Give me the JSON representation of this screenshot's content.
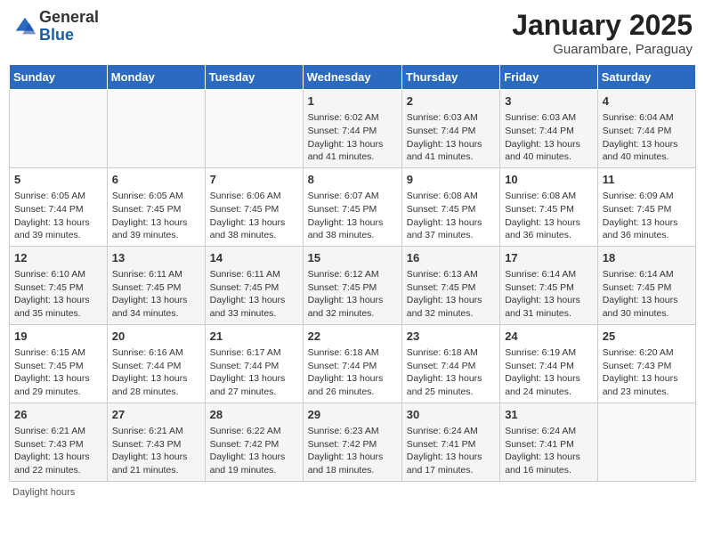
{
  "header": {
    "logo_general": "General",
    "logo_blue": "Blue",
    "month_year": "January 2025",
    "location": "Guarambare, Paraguay"
  },
  "footer": {
    "daylight_label": "Daylight hours"
  },
  "calendar": {
    "days_of_week": [
      "Sunday",
      "Monday",
      "Tuesday",
      "Wednesday",
      "Thursday",
      "Friday",
      "Saturday"
    ],
    "weeks": [
      [
        {
          "day": "",
          "info": ""
        },
        {
          "day": "",
          "info": ""
        },
        {
          "day": "",
          "info": ""
        },
        {
          "day": "1",
          "info": "Sunrise: 6:02 AM\nSunset: 7:44 PM\nDaylight: 13 hours\nand 41 minutes."
        },
        {
          "day": "2",
          "info": "Sunrise: 6:03 AM\nSunset: 7:44 PM\nDaylight: 13 hours\nand 41 minutes."
        },
        {
          "day": "3",
          "info": "Sunrise: 6:03 AM\nSunset: 7:44 PM\nDaylight: 13 hours\nand 40 minutes."
        },
        {
          "day": "4",
          "info": "Sunrise: 6:04 AM\nSunset: 7:44 PM\nDaylight: 13 hours\nand 40 minutes."
        }
      ],
      [
        {
          "day": "5",
          "info": "Sunrise: 6:05 AM\nSunset: 7:44 PM\nDaylight: 13 hours\nand 39 minutes."
        },
        {
          "day": "6",
          "info": "Sunrise: 6:05 AM\nSunset: 7:45 PM\nDaylight: 13 hours\nand 39 minutes."
        },
        {
          "day": "7",
          "info": "Sunrise: 6:06 AM\nSunset: 7:45 PM\nDaylight: 13 hours\nand 38 minutes."
        },
        {
          "day": "8",
          "info": "Sunrise: 6:07 AM\nSunset: 7:45 PM\nDaylight: 13 hours\nand 38 minutes."
        },
        {
          "day": "9",
          "info": "Sunrise: 6:08 AM\nSunset: 7:45 PM\nDaylight: 13 hours\nand 37 minutes."
        },
        {
          "day": "10",
          "info": "Sunrise: 6:08 AM\nSunset: 7:45 PM\nDaylight: 13 hours\nand 36 minutes."
        },
        {
          "day": "11",
          "info": "Sunrise: 6:09 AM\nSunset: 7:45 PM\nDaylight: 13 hours\nand 36 minutes."
        }
      ],
      [
        {
          "day": "12",
          "info": "Sunrise: 6:10 AM\nSunset: 7:45 PM\nDaylight: 13 hours\nand 35 minutes."
        },
        {
          "day": "13",
          "info": "Sunrise: 6:11 AM\nSunset: 7:45 PM\nDaylight: 13 hours\nand 34 minutes."
        },
        {
          "day": "14",
          "info": "Sunrise: 6:11 AM\nSunset: 7:45 PM\nDaylight: 13 hours\nand 33 minutes."
        },
        {
          "day": "15",
          "info": "Sunrise: 6:12 AM\nSunset: 7:45 PM\nDaylight: 13 hours\nand 32 minutes."
        },
        {
          "day": "16",
          "info": "Sunrise: 6:13 AM\nSunset: 7:45 PM\nDaylight: 13 hours\nand 32 minutes."
        },
        {
          "day": "17",
          "info": "Sunrise: 6:14 AM\nSunset: 7:45 PM\nDaylight: 13 hours\nand 31 minutes."
        },
        {
          "day": "18",
          "info": "Sunrise: 6:14 AM\nSunset: 7:45 PM\nDaylight: 13 hours\nand 30 minutes."
        }
      ],
      [
        {
          "day": "19",
          "info": "Sunrise: 6:15 AM\nSunset: 7:45 PM\nDaylight: 13 hours\nand 29 minutes."
        },
        {
          "day": "20",
          "info": "Sunrise: 6:16 AM\nSunset: 7:44 PM\nDaylight: 13 hours\nand 28 minutes."
        },
        {
          "day": "21",
          "info": "Sunrise: 6:17 AM\nSunset: 7:44 PM\nDaylight: 13 hours\nand 27 minutes."
        },
        {
          "day": "22",
          "info": "Sunrise: 6:18 AM\nSunset: 7:44 PM\nDaylight: 13 hours\nand 26 minutes."
        },
        {
          "day": "23",
          "info": "Sunrise: 6:18 AM\nSunset: 7:44 PM\nDaylight: 13 hours\nand 25 minutes."
        },
        {
          "day": "24",
          "info": "Sunrise: 6:19 AM\nSunset: 7:44 PM\nDaylight: 13 hours\nand 24 minutes."
        },
        {
          "day": "25",
          "info": "Sunrise: 6:20 AM\nSunset: 7:43 PM\nDaylight: 13 hours\nand 23 minutes."
        }
      ],
      [
        {
          "day": "26",
          "info": "Sunrise: 6:21 AM\nSunset: 7:43 PM\nDaylight: 13 hours\nand 22 minutes."
        },
        {
          "day": "27",
          "info": "Sunrise: 6:21 AM\nSunset: 7:43 PM\nDaylight: 13 hours\nand 21 minutes."
        },
        {
          "day": "28",
          "info": "Sunrise: 6:22 AM\nSunset: 7:42 PM\nDaylight: 13 hours\nand 19 minutes."
        },
        {
          "day": "29",
          "info": "Sunrise: 6:23 AM\nSunset: 7:42 PM\nDaylight: 13 hours\nand 18 minutes."
        },
        {
          "day": "30",
          "info": "Sunrise: 6:24 AM\nSunset: 7:41 PM\nDaylight: 13 hours\nand 17 minutes."
        },
        {
          "day": "31",
          "info": "Sunrise: 6:24 AM\nSunset: 7:41 PM\nDaylight: 13 hours\nand 16 minutes."
        },
        {
          "day": "",
          "info": ""
        }
      ]
    ]
  }
}
